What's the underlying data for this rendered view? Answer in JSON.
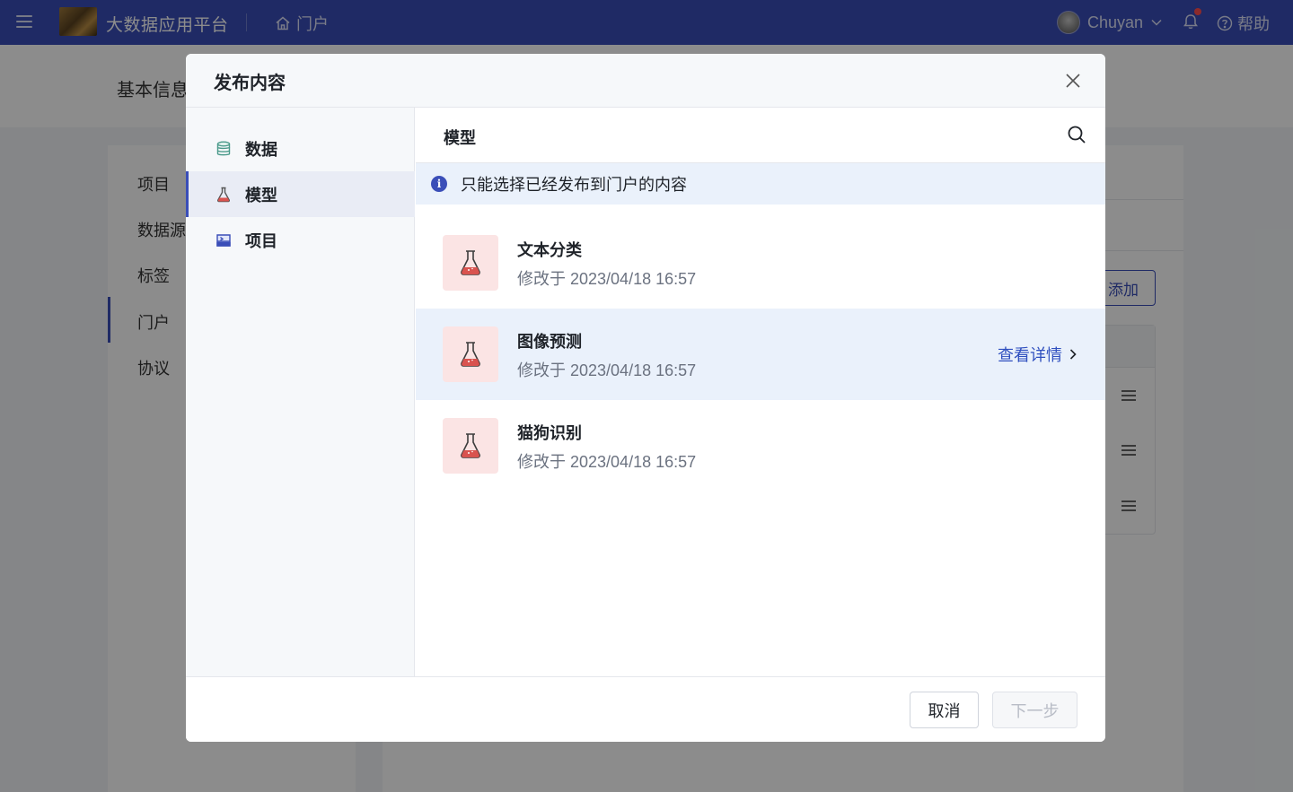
{
  "topbar": {
    "platform_name": "大数据应用平台",
    "home_label": "门户",
    "user_name": "Chuyan",
    "help_label": "帮助"
  },
  "background": {
    "page_title": "基本信息",
    "side_items": [
      "项目",
      "数据源",
      "标签",
      "门户",
      "协议"
    ],
    "add_button": "添加"
  },
  "modal": {
    "title": "发布内容",
    "side_items": [
      {
        "label": "数据",
        "icon": "database-icon"
      },
      {
        "label": "模型",
        "icon": "flask-icon"
      },
      {
        "label": "项目",
        "icon": "project-icon"
      }
    ],
    "active_side_item": "模型",
    "content_title": "模型",
    "notice": "只能选择已经发布到门户的内容",
    "items": [
      {
        "name": "文本分类",
        "meta": "修改于 2023/04/18 16:57"
      },
      {
        "name": "图像预测",
        "meta": "修改于 2023/04/18 16:57",
        "link": "查看详情"
      },
      {
        "name": "猫狗识别",
        "meta": "修改于 2023/04/18 16:57"
      }
    ],
    "cancel_label": "取消",
    "next_label": "下一步"
  },
  "colors": {
    "primary": "#3a4eb8",
    "link": "#2f4fbf",
    "notice_bg": "#eaf1fb",
    "thumb_bg": "#fbe4e4",
    "flask_fill": "#d9534f"
  }
}
